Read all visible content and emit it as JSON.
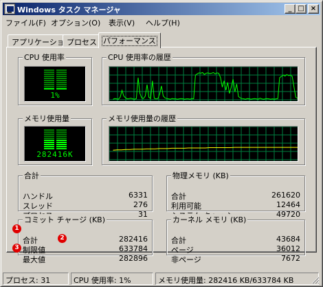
{
  "window": {
    "title": "Windows タスク マネージャ",
    "controls": {
      "minimize": "_",
      "maximize": "□",
      "close": "×"
    }
  },
  "menu": [
    {
      "label": "ファイル(F)"
    },
    {
      "label": "オプション(O)"
    },
    {
      "label": "表示(V)"
    },
    {
      "label": "ヘルプ(H)"
    }
  ],
  "tabs": [
    {
      "label": "アプリケーション",
      "active": false
    },
    {
      "label": "プロセス",
      "active": false
    },
    {
      "label": "パフォーマンス",
      "active": true
    }
  ],
  "cpu_usage": {
    "title": "CPU 使用率",
    "readout": "1%",
    "level": 0.01
  },
  "cpu_history": {
    "title": "CPU 使用率の履歴",
    "color": "#00ff00"
  },
  "mem_usage": {
    "title": "メモリ使用量",
    "readout": "282416K",
    "level": 0.45
  },
  "mem_history": {
    "title": "メモリ使用量の履歴",
    "color": "#ffff00"
  },
  "totals": {
    "title": "合計",
    "rows": [
      {
        "label": "ハンドル",
        "value": "6331"
      },
      {
        "label": "スレッド",
        "value": "276"
      },
      {
        "label": "プロセス",
        "value": "31"
      }
    ]
  },
  "physical_memory": {
    "title": "物理メモリ (KB)",
    "rows": [
      {
        "label": "合計",
        "value": "261620"
      },
      {
        "label": "利用可能",
        "value": "12464"
      },
      {
        "label": "システム キャッシュ",
        "value": "49720"
      }
    ]
  },
  "commit_charge": {
    "title": "コミット チャージ (KB)",
    "rows": [
      {
        "label": "合計",
        "value": "282416",
        "callout": "1"
      },
      {
        "label": "制限値",
        "value": "633784",
        "callout": "2"
      },
      {
        "label": "最大値",
        "value": "282896",
        "callout": "3"
      }
    ]
  },
  "kernel_memory": {
    "title": "カーネル メモリ (KB)",
    "rows": [
      {
        "label": "合計",
        "value": "43684"
      },
      {
        "label": "ページ",
        "value": "36012"
      },
      {
        "label": "非ページ",
        "value": "7672"
      }
    ]
  },
  "status": {
    "processes": "プロセス: 31",
    "cpu": "CPU 使用率: 1%",
    "memory": "メモリ使用量: 282416 KB/633784 KB"
  },
  "colors": {
    "graph_grid": "#008040",
    "cpu_line": "#00ff00",
    "mem_line": "#ffff00",
    "callout": "#e00000"
  },
  "cpu_history_series": [
    2,
    4,
    3,
    2,
    8,
    30,
    12,
    6,
    3,
    4,
    5,
    3,
    2,
    4,
    70,
    20,
    6,
    4,
    12,
    48,
    8,
    4,
    60,
    5,
    3,
    4,
    18,
    44,
    12,
    6,
    4,
    3,
    2,
    4,
    3,
    3,
    2,
    3,
    4,
    3,
    2,
    3,
    3,
    2,
    4,
    3,
    78,
    82,
    85,
    84,
    86,
    80,
    84,
    85,
    83,
    84,
    86,
    82,
    85,
    84,
    70,
    40,
    60,
    30,
    55,
    20,
    40,
    65,
    25,
    50,
    10,
    6,
    4,
    3,
    2,
    4,
    3,
    2,
    3,
    4,
    3,
    2,
    5,
    3,
    2,
    3,
    4,
    3,
    2,
    3,
    2,
    3,
    4,
    70,
    74,
    78,
    75,
    80,
    76,
    78,
    74,
    40,
    8,
    5
  ],
  "mem_history_series": [
    0.3,
    0.31,
    0.31,
    0.32,
    0.32,
    0.33,
    0.33,
    0.33,
    0.34,
    0.34,
    0.34,
    0.35,
    0.35,
    0.35,
    0.36,
    0.36,
    0.36,
    0.36,
    0.37,
    0.37,
    0.37,
    0.37,
    0.37,
    0.38,
    0.38,
    0.38,
    0.38,
    0.38,
    0.38,
    0.39,
    0.39,
    0.39,
    0.39,
    0.39,
    0.39,
    0.39,
    0.39,
    0.39,
    0.39,
    0.39,
    0.39,
    0.39,
    0.39,
    0.39,
    0.39
  ]
}
